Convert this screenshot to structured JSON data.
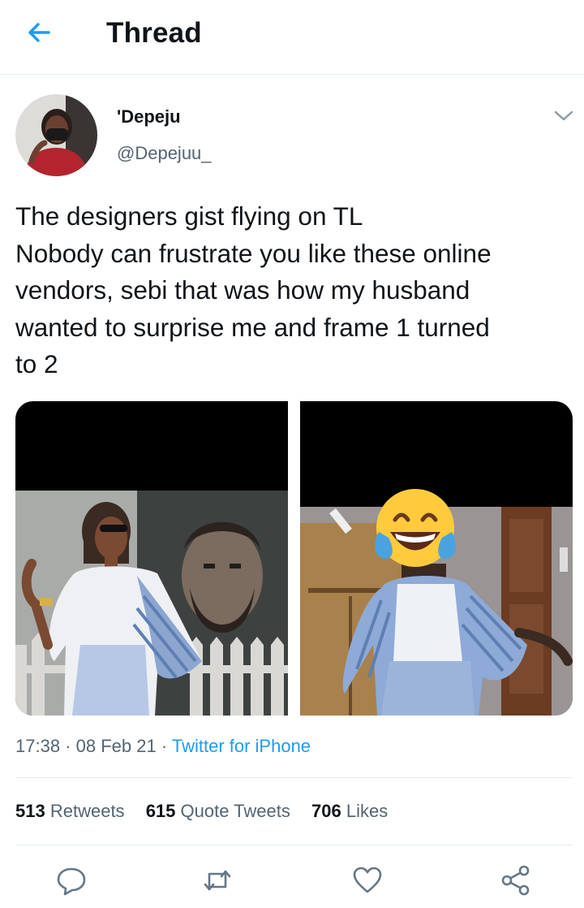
{
  "header": {
    "title": "Thread",
    "back_icon": "arrow-left-icon",
    "accent": "#1d9bf0"
  },
  "tweet": {
    "author": {
      "display_name": "'Depeju",
      "handle": "@Depejuu_"
    },
    "text_lines": [
      "The designers gist flying on TL",
      "Nobody can frustrate you like these online",
      "vendors, sebi that was how my husband",
      "wanted to surprise me and frame 1 turned",
      "to 2"
    ],
    "media": [
      {
        "name": "dress-photo-original"
      },
      {
        "name": "dress-photo-received",
        "overlay_icon": "tears-of-joy-emoji-icon"
      }
    ],
    "time": "17:38",
    "date": "08 Feb 21",
    "separator": " · ",
    "source": "Twitter for iPhone",
    "stats": {
      "retweets": {
        "count": "513",
        "label": "Retweets"
      },
      "quotes": {
        "count": "615",
        "label": "Quote Tweets"
      },
      "likes": {
        "count": "706",
        "label": "Likes"
      }
    }
  },
  "actions": [
    {
      "icon": "reply-icon"
    },
    {
      "icon": "retweet-icon"
    },
    {
      "icon": "like-icon"
    },
    {
      "icon": "share-icon"
    }
  ],
  "colors": {
    "text": "#0f1419",
    "secondary": "#536471",
    "link": "#1d9bf0",
    "divider": "#e6ecf0"
  }
}
